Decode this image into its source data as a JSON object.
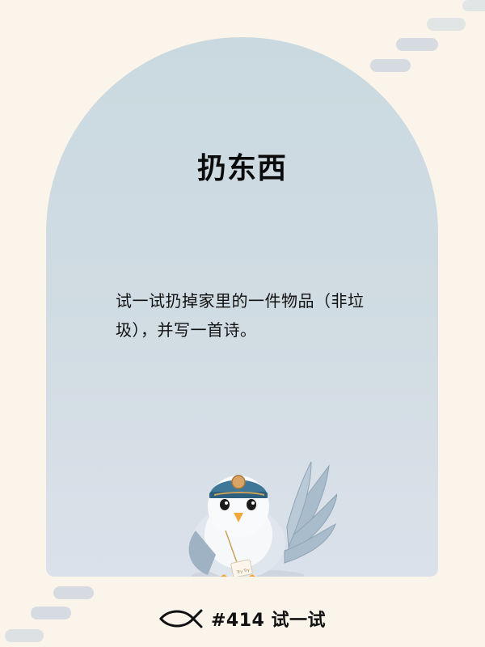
{
  "card": {
    "title": "扔东西",
    "prompt": "试一试扔掉家里的一件物品（非垃圾），并写一首诗。"
  },
  "illustration": {
    "subject": "pigeon-mail-carrier-icon",
    "envelope_text": "Try Try"
  },
  "footer": {
    "tag": "#414 试一试"
  },
  "colors": {
    "background": "#faf4ea",
    "arch": "#cad9e0",
    "text": "#111111"
  }
}
